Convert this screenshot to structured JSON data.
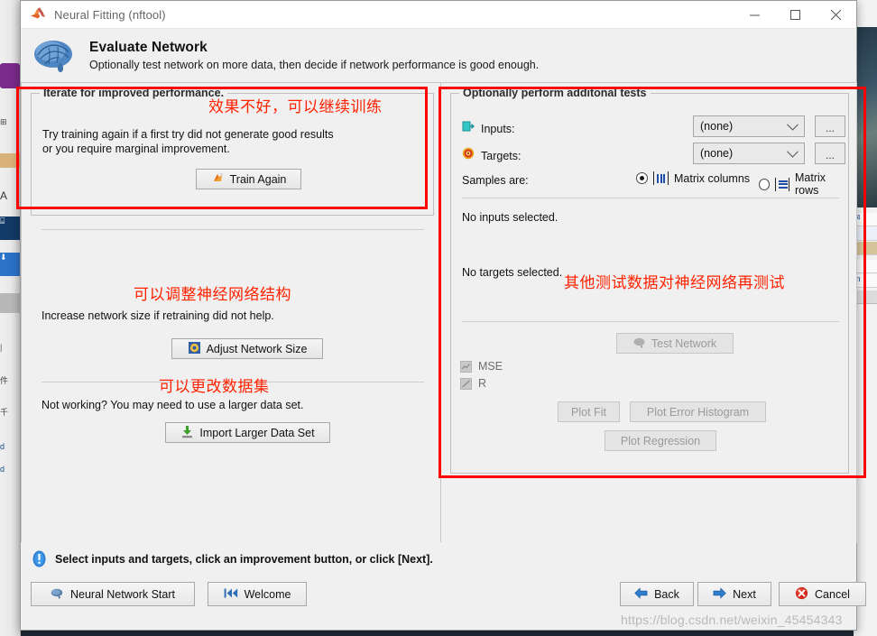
{
  "window": {
    "title": "Neural Fitting (nftool)",
    "app_icon": "matlab-icon",
    "minimize": "—",
    "maximize": "□",
    "close": "✕"
  },
  "header": {
    "icon": "brain-icon",
    "title": "Evaluate Network",
    "subtitle": "Optionally test network on more data, then decide if network performance is good enough."
  },
  "left_panel": {
    "group_legend": "Iterate for improved performance.",
    "retrain_text_line1": "Try training again if a first try did not generate good results",
    "retrain_text_line2": "or you require marginal improvement.",
    "train_again_button": "Train Again",
    "train_again_icon": "retrain-icon",
    "increase_text": "Increase network size if retraining did not help.",
    "adjust_button": "Adjust Network Size",
    "adjust_icon": "network-size-icon",
    "larger_data_text": "Not working? You may need to use a larger data set.",
    "import_button": "Import Larger Data Set",
    "import_icon": "import-icon"
  },
  "right_panel": {
    "group_legend": "Optionally perform additonal tests",
    "inputs_label": "Inputs:",
    "inputs_icon": "inputs-icon",
    "inputs_value": "(none)",
    "inputs_browse": "...",
    "targets_label": "Targets:",
    "targets_icon": "targets-icon",
    "targets_value": "(none)",
    "targets_browse": "...",
    "samples_label": "Samples are:",
    "samples_columns": "Matrix columns",
    "samples_columns_selected": true,
    "samples_rows": "Matrix rows",
    "samples_rows_selected": false,
    "no_inputs_text": "No inputs selected.",
    "no_targets_text": "No targets selected.",
    "test_network_button": "Test Network",
    "test_network_icon": "brain-small-icon",
    "mse_label": "MSE",
    "mse_icon": "mse-icon",
    "r_label": "R",
    "r_icon": "r-icon",
    "plot_fit_button": "Plot Fit",
    "plot_error_hist_button": "Plot Error Histogram",
    "plot_regression_button": "Plot Regression"
  },
  "annotations": {
    "note_train_again": "效果不好，可以继续训练",
    "note_adjust": "可以调整神经网络结构",
    "note_dataset": "可以更改数据集",
    "note_test": "其他测试数据对神经网络再测试",
    "box_color": "#ff0000",
    "text_color": "#ff2200"
  },
  "footer": {
    "status_icon": "info-icon",
    "status_text": "Select inputs and targets, click an improvement button, or click [Next].",
    "neural_start_button": "Neural Network Start",
    "neural_start_icon": "brain-small-icon",
    "welcome_button": "Welcome",
    "welcome_icon": "skip-back-icon",
    "back_button": "Back",
    "back_icon": "arrow-left-icon",
    "next_button": "Next",
    "next_icon": "arrow-right-icon",
    "cancel_button": "Cancel",
    "cancel_icon": "cancel-icon"
  },
  "watermark": {
    "text": "https://blog.csdn.net/weixin_45454343"
  }
}
